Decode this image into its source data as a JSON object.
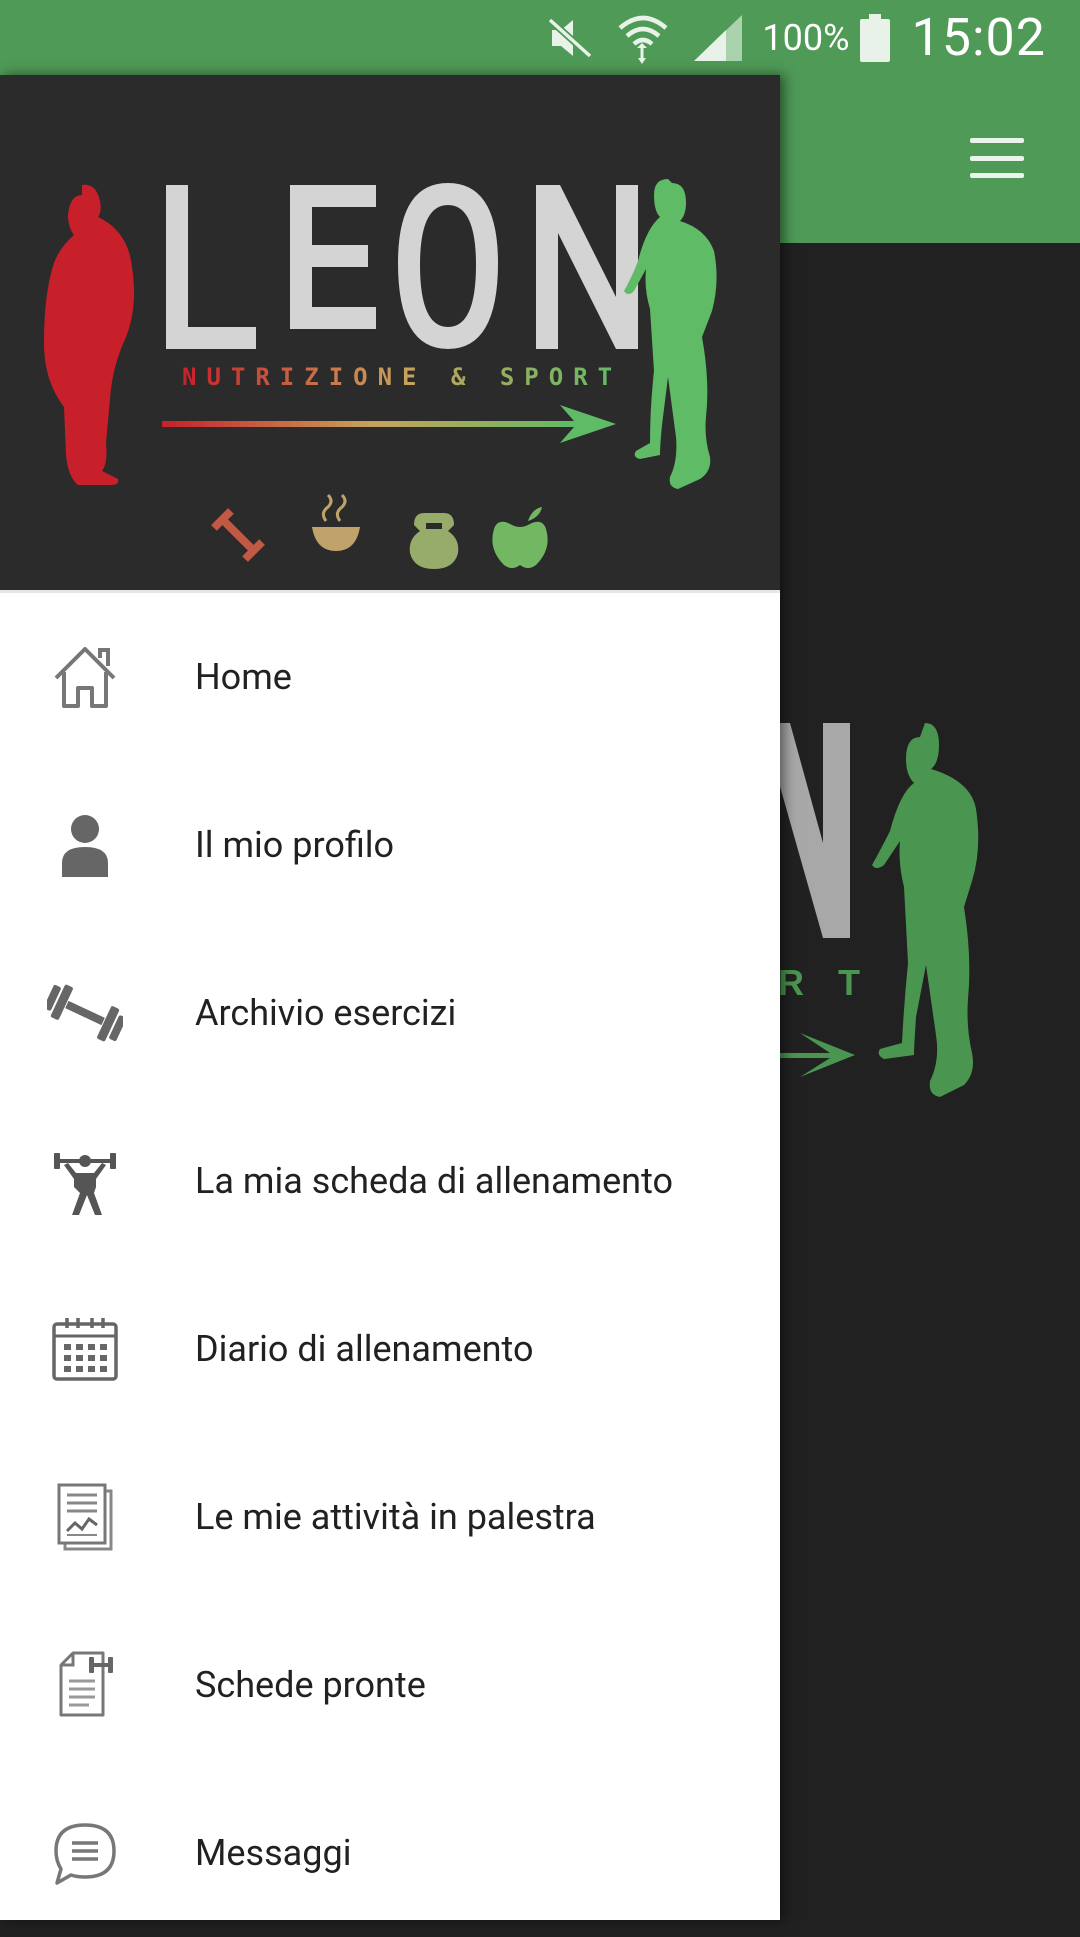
{
  "status_bar": {
    "battery_percent": "100%",
    "time": "15:02",
    "icons": [
      "mute-icon",
      "wifi-icon",
      "signal-icon",
      "battery-icon"
    ]
  },
  "app_bar": {
    "menu_icon": "hamburger-menu-icon"
  },
  "drawer": {
    "logo": {
      "name": "LEON",
      "tagline": "NUTRIZIONE & SPORT"
    },
    "items": [
      {
        "label": "Home",
        "icon": "home-icon"
      },
      {
        "label": "Il mio profilo",
        "icon": "user-profile-icon"
      },
      {
        "label": "Archivio esercizi",
        "icon": "dumbbell-icon"
      },
      {
        "label": "La mia scheda di allenamento",
        "icon": "weightlifter-icon"
      },
      {
        "label": "Diario di allenamento",
        "icon": "calendar-icon"
      },
      {
        "label": "Le mie attività in palestra",
        "icon": "activity-report-icon"
      },
      {
        "label": "Schede pronte",
        "icon": "ready-plan-document-icon"
      },
      {
        "label": "Messaggi",
        "icon": "message-bubble-icon"
      }
    ]
  },
  "colors": {
    "primary": "#4f9a57",
    "drawer_header": "#2b2b2b",
    "background": "#212121",
    "logo_red": "#c8202a",
    "logo_green": "#5fbb66",
    "icon_gray": "#666666",
    "text": "#212121"
  }
}
